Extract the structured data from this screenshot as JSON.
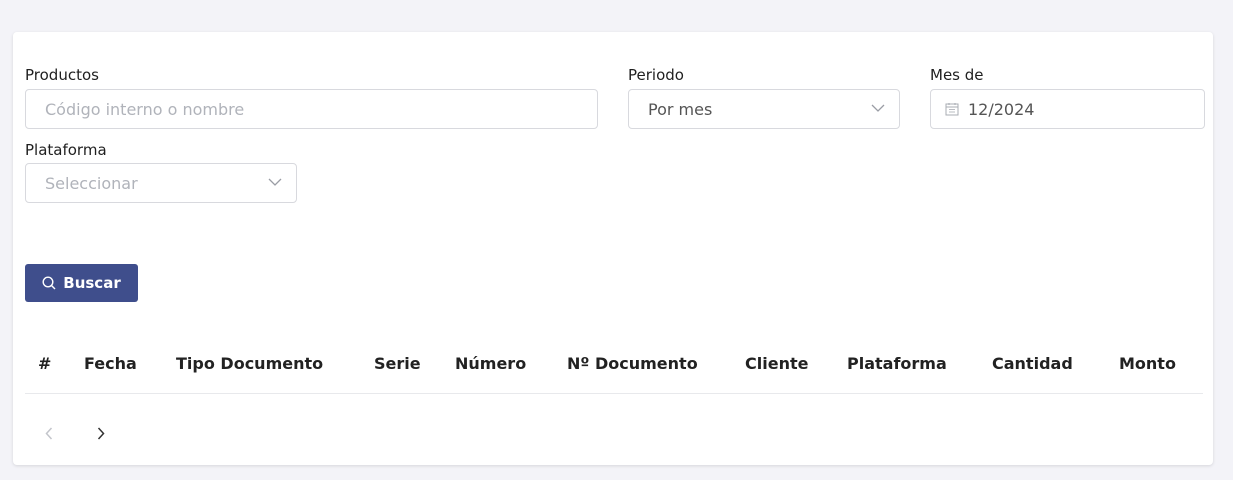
{
  "filters": {
    "productos": {
      "label": "Productos",
      "placeholder": "Código interno o nombre"
    },
    "periodo": {
      "label": "Periodo",
      "value": "Por mes"
    },
    "mes_de": {
      "label": "Mes de",
      "value": "12/2024"
    },
    "plataforma": {
      "label": "Plataforma",
      "placeholder": "Seleccionar"
    }
  },
  "search_button": {
    "label": "Buscar",
    "icon": "search-icon",
    "color": "#3f4e8c"
  },
  "table": {
    "columns": [
      "#",
      "Fecha",
      "Tipo Documento",
      "Serie",
      "Número",
      "Nº Documento",
      "Cliente",
      "Plataforma",
      "Cantidad",
      "Monto"
    ]
  },
  "pagination": {
    "prev_icon": "chevron-left-icon",
    "next_icon": "chevron-right-icon"
  }
}
